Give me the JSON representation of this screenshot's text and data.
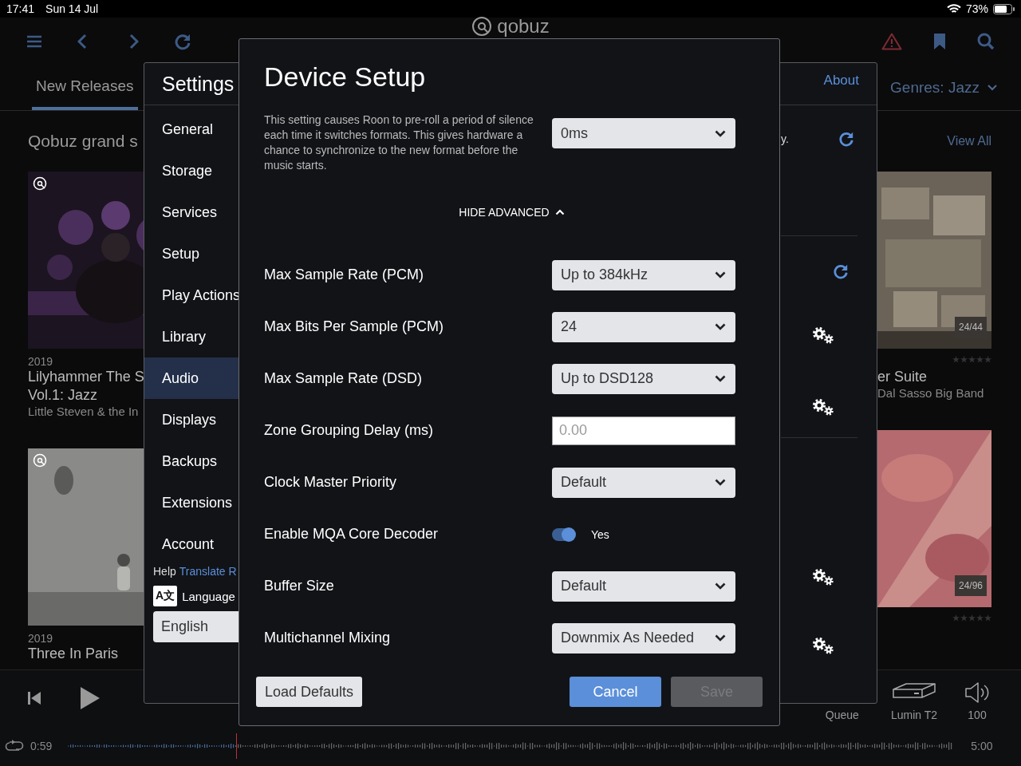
{
  "status_bar": {
    "time": "17:41",
    "date": "Sun 14 Jul",
    "battery": "73%"
  },
  "toolbar": {
    "logo": "qobuz"
  },
  "tabs": [
    {
      "label": "New Releases",
      "selected": true
    }
  ],
  "genre_filter": {
    "label": "Genres: Jazz"
  },
  "section": {
    "title": "Qobuz grand s",
    "link": "View All"
  },
  "albums_left": [
    {
      "year": "2019",
      "title": "Lilyhammer The S",
      "title_2": "Vol.1: Jazz",
      "artist": "Little Steven & the In"
    },
    {
      "year": "2019",
      "title": "Three In Paris"
    }
  ],
  "albums_right": [
    {
      "badge": "24/44",
      "stars": 0,
      "title": "er Suite",
      "artist": "Dal Sasso Big Band"
    },
    {
      "badge": "24/96",
      "stars": 0
    }
  ],
  "settings": {
    "title": "Settings",
    "about_link": "About",
    "side_text": "y.",
    "items": [
      {
        "label": "General",
        "selected": false
      },
      {
        "label": "Storage",
        "selected": false
      },
      {
        "label": "Services",
        "selected": false
      },
      {
        "label": "Setup",
        "selected": false
      },
      {
        "label": "Play Actions",
        "selected": false
      },
      {
        "label": "Library",
        "selected": false
      },
      {
        "label": "Audio",
        "selected": true
      },
      {
        "label": "Displays",
        "selected": false
      },
      {
        "label": "Backups",
        "selected": false
      },
      {
        "label": "Extensions",
        "selected": false
      },
      {
        "label": "Account",
        "selected": false
      }
    ],
    "help": "Help",
    "translate_link": "Translate R",
    "language_badge": "A文",
    "language_label": "Language",
    "language_value": "English"
  },
  "dialog": {
    "title": "Device Setup",
    "description": "This setting causes Roon to pre-roll a period of silence each time it switches formats. This gives hardware a chance to synchronize to the new format before the music starts.",
    "description_value": "0ms",
    "advanced_toggle": "HIDE ADVANCED",
    "rows": [
      {
        "label": "Max Sample Rate (PCM)",
        "kind": "select",
        "value": "Up to 384kHz"
      },
      {
        "label": "Max Bits Per Sample (PCM)",
        "kind": "select",
        "value": "24"
      },
      {
        "label": "Max Sample Rate (DSD)",
        "kind": "select",
        "value": "Up to DSD128"
      },
      {
        "label": "Zone Grouping Delay (ms)",
        "kind": "input",
        "placeholder": "0.00"
      },
      {
        "label": "Clock Master Priority",
        "kind": "select",
        "value": "Default"
      },
      {
        "label": "Enable MQA Core Decoder",
        "kind": "toggle",
        "on": true,
        "value": "Yes"
      },
      {
        "label": "Buffer Size",
        "kind": "select",
        "value": "Default"
      },
      {
        "label": "Multichannel Mixing",
        "kind": "select",
        "value": "Downmix As Needed"
      }
    ],
    "buttons": [
      {
        "label": "Load Defaults",
        "kind": "secondary",
        "disabled": false
      },
      {
        "label": "Cancel",
        "kind": "primary",
        "disabled": false
      },
      {
        "label": "Save",
        "kind": "primary",
        "disabled": true
      }
    ]
  },
  "player": {
    "queue": "Queue",
    "zone": "Lumin T2",
    "volume": "100",
    "elapsed": "0:59",
    "total": "5:00",
    "level": 0.19
  }
}
